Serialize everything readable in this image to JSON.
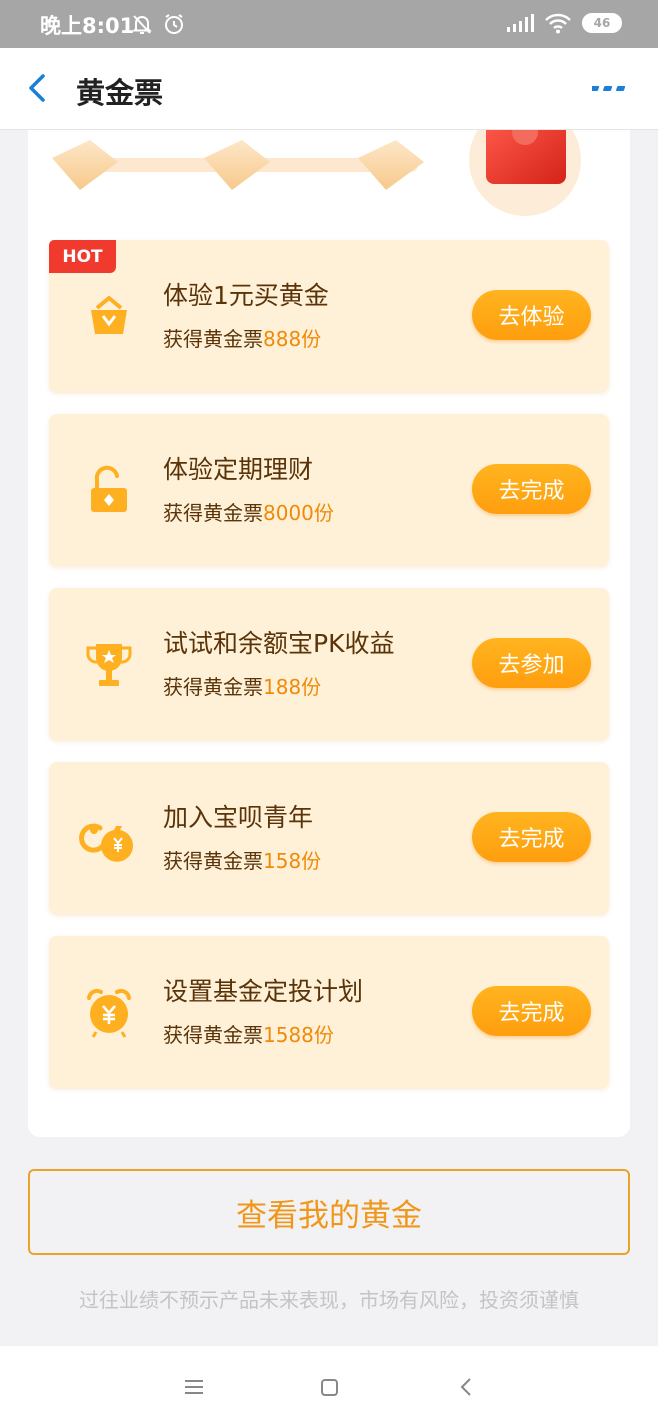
{
  "status_bar": {
    "time": "晚上8:01",
    "icons": [
      "mute-bell-icon",
      "alarm-icon",
      "signal-icon",
      "wifi-icon"
    ],
    "battery": "46"
  },
  "nav": {
    "title": "黄金票",
    "back_icon": "chevron-left-icon",
    "more_icon": "more-icon",
    "accent": "#1a7fd6"
  },
  "tasks": [
    {
      "badge": "HOT",
      "icon": "gold-basket-icon",
      "title": "体验1元买黄金",
      "desc_prefix": "获得黄金票",
      "desc_value": "888份",
      "button": "去体验"
    },
    {
      "icon": "unlock-icon",
      "title": "体验定期理财",
      "desc_prefix": "获得黄金票",
      "desc_value": "8000份",
      "button": "去完成"
    },
    {
      "icon": "trophy-icon",
      "title": "试试和余额宝PK收益",
      "desc_prefix": "获得黄金票",
      "desc_value": "188份",
      "button": "去参加"
    },
    {
      "icon": "money-bag-icon",
      "title": "加入宝呗青年",
      "desc_prefix": "获得黄金票",
      "desc_value": "158份",
      "button": "去完成"
    },
    {
      "icon": "alarm-clock-yuan-icon",
      "title": "设置基金定投计划",
      "desc_prefix": "获得黄金票",
      "desc_value": "1588份",
      "button": "去完成"
    }
  ],
  "view_gold_button": "查看我的黄金",
  "disclaimer": "过往业绩不预示产品未来表现，市场有风险，投资须谨慎",
  "colors": {
    "task_bg": "#fff0d8",
    "button": "#ffa915",
    "highlight": "#f08a08",
    "hot": "#f13a2e"
  },
  "system_nav": [
    "menu-icon",
    "home-icon",
    "back-icon"
  ]
}
